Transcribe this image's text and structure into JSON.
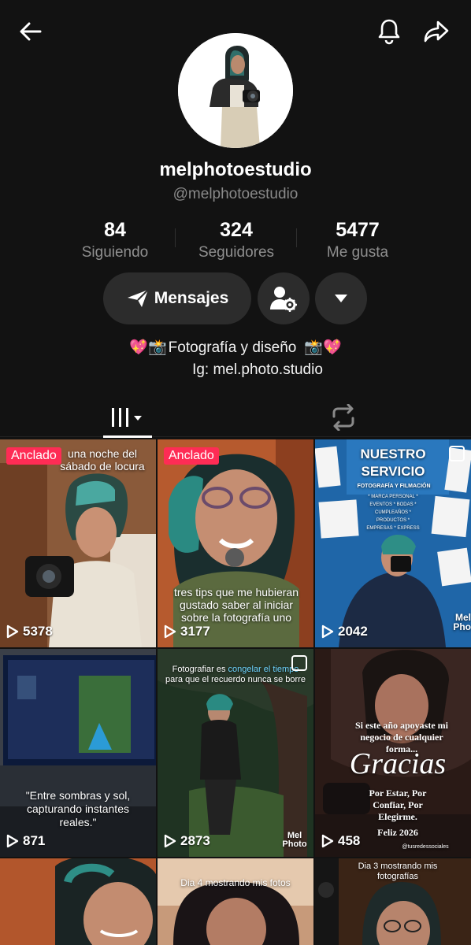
{
  "profile": {
    "display_name": "melphotoestudio",
    "handle": "@melphotoestudio"
  },
  "stats": {
    "following_count": "84",
    "following_label": "Siguiendo",
    "followers_count": "324",
    "followers_label": "Seguidores",
    "likes_count": "5477",
    "likes_label": "Me gusta"
  },
  "actions": {
    "message_label": "Mensajes"
  },
  "bio": {
    "line1_emoji_left": "💖📸",
    "line1_text": "Fotografía y diseño",
    "line1_emoji_right": "📸💖",
    "line2": "Ig: mel.photo.studio"
  },
  "icons": {
    "back": "arrow-left-icon",
    "bell": "bell-icon",
    "share": "share-arrow-icon",
    "message": "paper-plane-icon",
    "friend": "user-gear-icon",
    "more": "triangle-down-icon",
    "grid_tab": "grid-bars-icon",
    "repost_tab": "repost-icon",
    "views": "play-outline-icon"
  },
  "colors": {
    "background": "#121212",
    "pinned_badge": "#fe2c55",
    "button_bg": "#2c2c2c"
  },
  "videos": [
    {
      "pinned_label": "Anclado",
      "views": "5378",
      "caption": "una noche del sábado de locura"
    },
    {
      "pinned_label": "Anclado",
      "views": "3177",
      "caption": "tres tips que me hubieran gustado saber al iniciar sobre la fotografía uno"
    },
    {
      "views": "2042",
      "title": "NUESTRO SERVICIO",
      "subtitle": "FOTOGRAFÍA Y FILMACIÓN",
      "list": "* MARCA PERSONAL * EVENTOS * BODAS * CUMPLEAÑOS * PRODUCTOS * EMPRESAS * EXPRESS",
      "brand": "Mel Pho"
    },
    {
      "views": "871",
      "caption": "\"Entre sombras y sol, capturando instantes reales.\""
    },
    {
      "views": "2873",
      "caption_pre": "Fotografiar es ",
      "caption_hi": "congelar el tiempo",
      "caption_post": " para que el recuerdo nunca se borre",
      "brand": "Mel Photo"
    },
    {
      "views": "458",
      "caption": "Si este año apoyaste mi negocio de cualquier forma...",
      "big": "Gracias",
      "sub": "Por Estar, Por Confiar, Por Elegirme.",
      "year": "Feliz 2026",
      "credit": "@tusredessociales"
    },
    {
      "caption": ""
    },
    {
      "caption": "Dia 4 mostrando mis fotos"
    },
    {
      "caption": "Dia 3 mostrando mis fotografías"
    }
  ]
}
